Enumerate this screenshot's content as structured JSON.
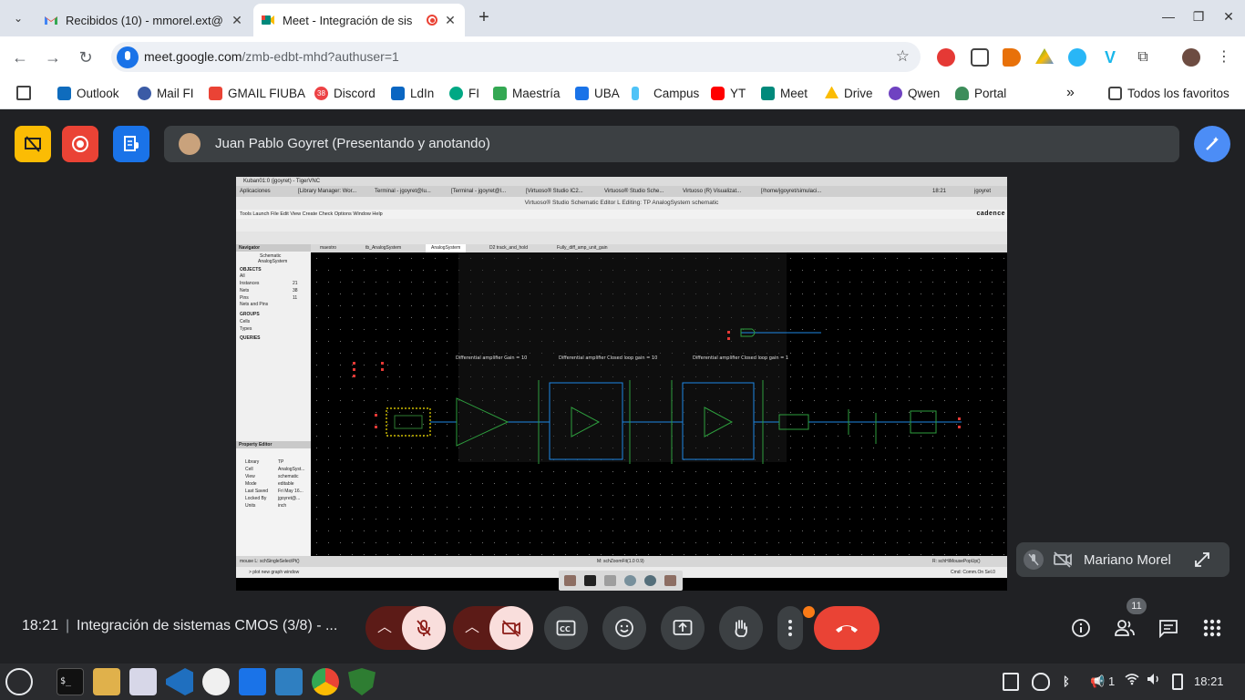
{
  "browser": {
    "tabs": [
      {
        "title": "Recibidos (10) - mmorel.ext@",
        "active": false,
        "icon": "gmail-icon"
      },
      {
        "title": "Meet - Integración de sis",
        "active": true,
        "icon": "meet-icon",
        "recording": true
      }
    ],
    "new_tab": "+",
    "url_host": "meet.google.com",
    "url_path": "/zmb-edbt-mhd?authuser=1",
    "bookmarks": [
      {
        "label": "Outlook",
        "color": "#0f6cbd"
      },
      {
        "label": "Mail FI",
        "color": "#3b5ba5"
      },
      {
        "label": "GMAIL FIUBA",
        "color": "#ea4335"
      },
      {
        "label": "Discord",
        "color": "#ed4245",
        "badge": "38"
      },
      {
        "label": "LdIn",
        "color": "#0a66c2"
      },
      {
        "label": "FI",
        "color": "#00a884"
      },
      {
        "label": "Maestría",
        "color": "#34a853"
      },
      {
        "label": "UBA",
        "color": "#1a73e8"
      },
      {
        "label": "Campus",
        "color": "#4fc3f7"
      },
      {
        "label": "YT",
        "color": "#ff0000"
      },
      {
        "label": "Meet",
        "color": "#00897b"
      },
      {
        "label": "Drive",
        "color": "#fbbc04"
      },
      {
        "label": "Qwen",
        "color": "#6f42c1"
      },
      {
        "label": "Portal",
        "color": "#3c8d5a"
      }
    ],
    "bookmarks_overflow": "»",
    "all_bookmarks": "Todos los favoritos"
  },
  "meet": {
    "presenter_label": "Juan Pablo Goyret (Presentando y anotando)",
    "self_name": "Mariano Morel",
    "clock": "18:21",
    "separator": "|",
    "meeting_title": "Integración de sistemas CMOS (3/8) - ...",
    "participants_count": "11",
    "colors": {
      "record": "#ea4335",
      "present_off": "#fbbc04",
      "captions": "#1a73e8",
      "hangup": "#ea4335",
      "muted_bg": "#f9dedc"
    }
  },
  "shared_screen": {
    "vnc_title": "Kuban01:0 (jgoyret) - TigerVNC",
    "taskbar_items": [
      "Aplicaciones",
      "[Library Manager: Wor...",
      "Terminal - jgoyret@lu...",
      "[Terminal - jgoyret@l...",
      "[Virtuoso® Studio IC2...",
      "Virtuoso® Studio Sche...",
      "Virtuoso (R) Visualizat...",
      "[/home/jgoyret/simulaci..."
    ],
    "taskbar_time": "18:21",
    "taskbar_user": "jgoyret",
    "virtuoso_title": "Virtuoso® Studio Schematic Editor L Editing: TP AnalogSystem schematic",
    "menu": "Tools  Launch  File  Edit  View  Create  Check  Options  Window  Help",
    "brand": "cadence",
    "tabs": [
      "maestro",
      "tb_AnalogSystem",
      "AnalogSystem",
      "D2 track_and_hold",
      "Fully_diff_amp_unit_gain"
    ],
    "navigator_title": "Navigator",
    "navigator_rows": [
      {
        "label": "Schematic",
        "value": ""
      },
      {
        "label": "AnalogSystem",
        "value": ""
      },
      {
        "label": "OBJECTS",
        "value": ""
      },
      {
        "label": "All",
        "value": ""
      },
      {
        "label": "Instances",
        "value": "21"
      },
      {
        "label": "Nets",
        "value": "38"
      },
      {
        "label": "Pins",
        "value": "11"
      },
      {
        "label": "Nets and Pins",
        "value": ""
      },
      {
        "label": "GROUPS",
        "value": ""
      },
      {
        "label": "Cells",
        "value": ""
      },
      {
        "label": "Types",
        "value": ""
      },
      {
        "label": "QUERIES",
        "value": ""
      }
    ],
    "property_title": "Property Editor",
    "property_rows": [
      {
        "label": "Library",
        "value": "TP"
      },
      {
        "label": "Cell",
        "value": "AnalogSyst..."
      },
      {
        "label": "View",
        "value": "schematic"
      },
      {
        "label": "Mode",
        "value": "editable"
      },
      {
        "label": "Last Saved",
        "value": "Fri May 16..."
      },
      {
        "label": "Locked By",
        "value": "jgoyret@..."
      },
      {
        "label": "Units",
        "value": "inch"
      }
    ],
    "annotations": [
      "Differential amplifier Gain = 10",
      "Differential amplifier Closed loop gain = 10",
      "Differential amplifier Closed loop gain = 1"
    ],
    "status_left": "mouse L: schSingleSelectPt()",
    "status_mid": "M: schZoomFit(1.0 0.9)",
    "status_right": "R: schHiMousePopUp()",
    "cmd_line": "> plot new graph window",
    "cmd_right": "Cmd:  Comm.On Sel.0"
  },
  "os_taskbar": {
    "tray": [
      "1"
    ],
    "time": "18:21"
  }
}
